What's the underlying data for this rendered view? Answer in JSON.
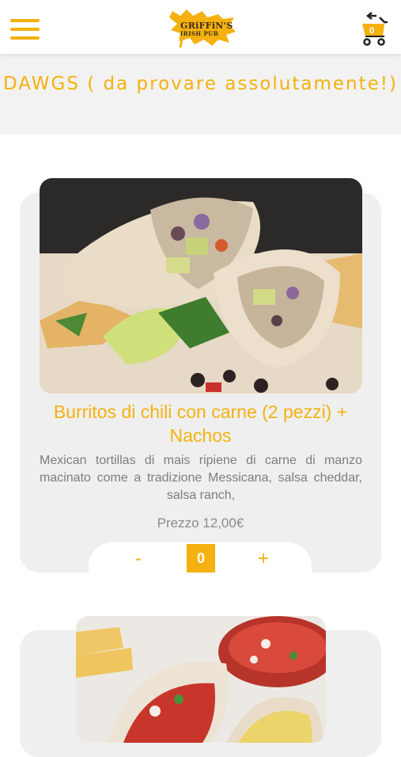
{
  "header": {
    "menu_icon": "hamburger-menu-icon",
    "logo_line1": "GRiFFiN'S",
    "logo_line2": "IRISH PUB",
    "cart_icon": "cart-with-back-arrow-icon",
    "cart_count": "0"
  },
  "category": {
    "title": "DAWGS ( da provare assolutamente!)"
  },
  "items": [
    {
      "title": "Burritos di chili con carne (2 pezzi) + Nachos",
      "description": "Mexican tortillas di mais ripiene di carne di manzo macinato come a tradizione Messicana, salsa cheddar, salsa ranch,",
      "price": "Prezzo 12,00€",
      "qty_minus": "-",
      "qty_value": "0",
      "qty_plus": "+"
    }
  ],
  "colors": {
    "accent": "#f4b10f",
    "card_bg": "#efefef",
    "band_bg": "#f2f2f2",
    "text_grey": "#7d7d7d"
  }
}
